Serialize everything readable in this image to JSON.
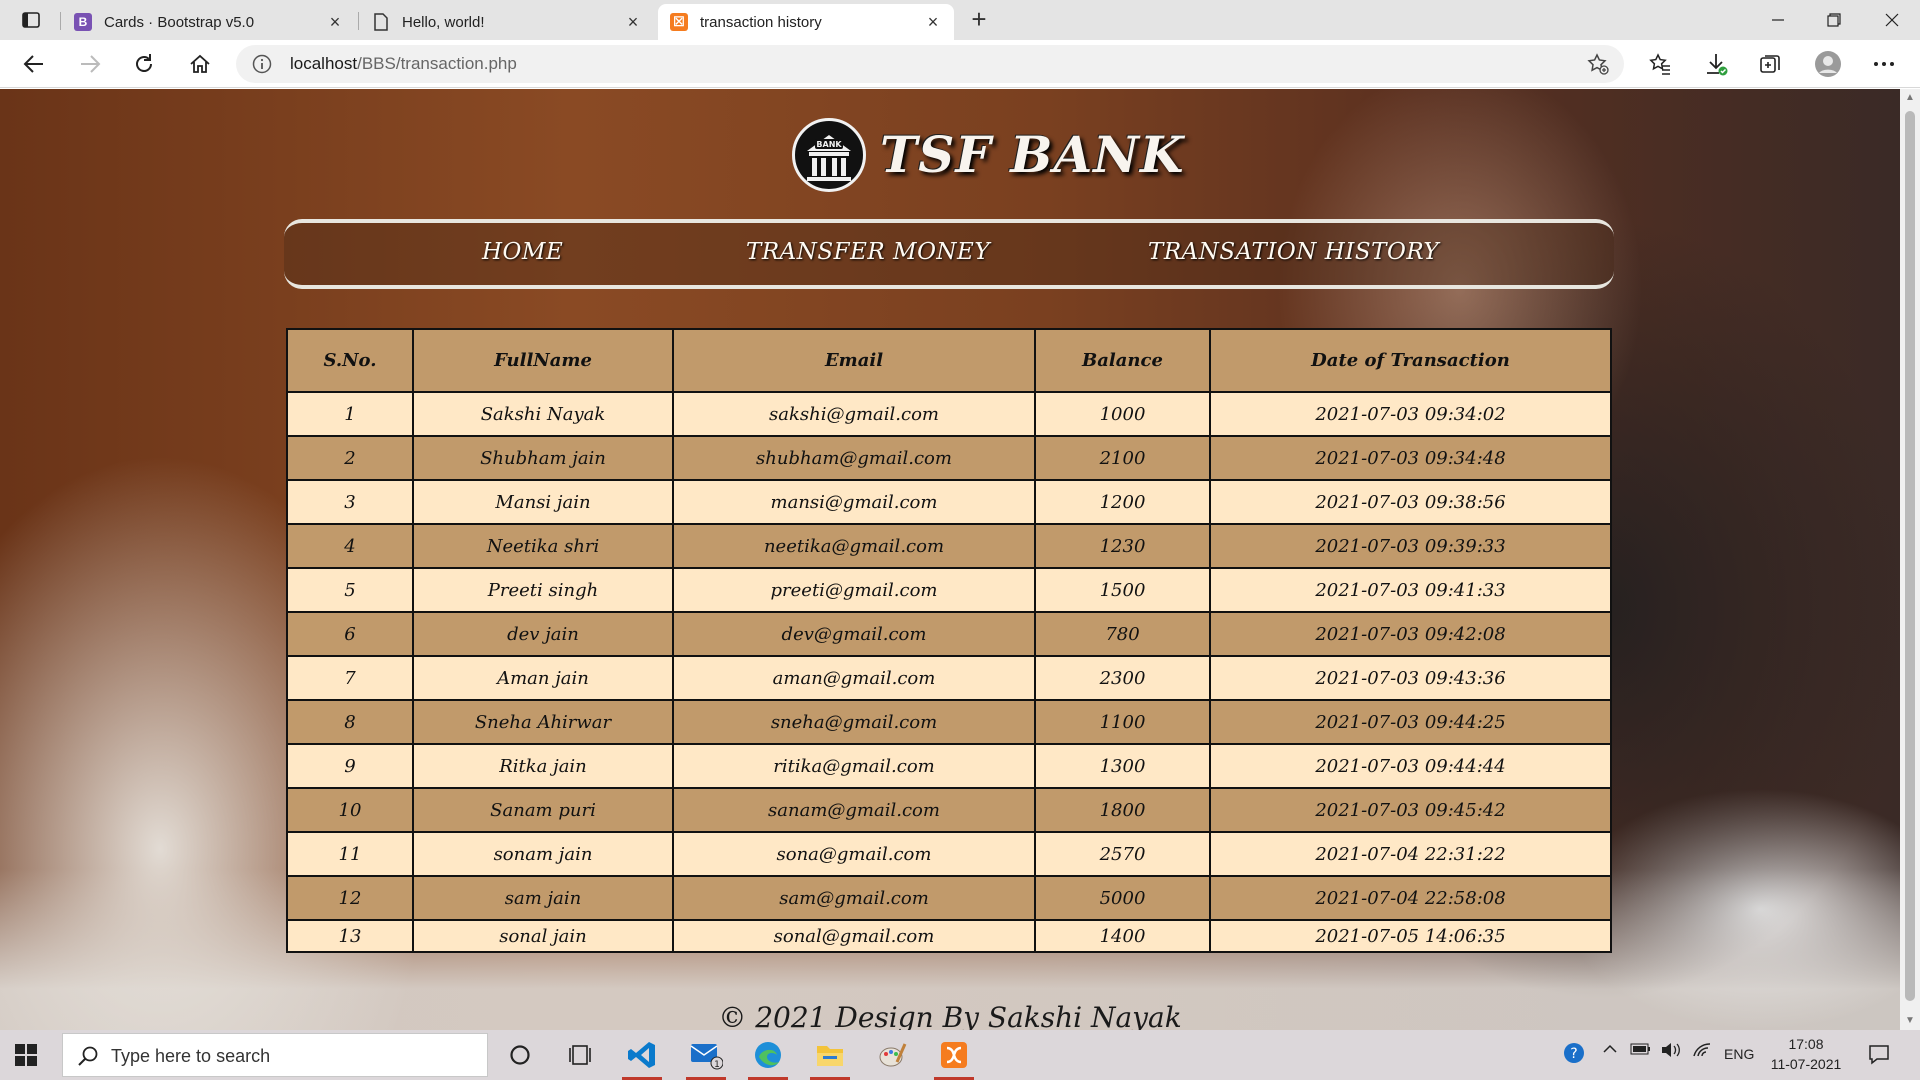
{
  "browser": {
    "tabs": [
      {
        "title": "Cards · Bootstrap v5.0",
        "favicon": "B",
        "favicon_color": "#7952b3"
      },
      {
        "title": "Hello, world!",
        "favicon": "",
        "favicon_color": "#ffffff"
      },
      {
        "title": "transaction history",
        "favicon": "☒",
        "favicon_color": "#f57c1f",
        "active": true
      }
    ],
    "url_host": "localhost",
    "url_path": "/BBS/transaction.php"
  },
  "page": {
    "brand": "TSF BANK",
    "logo_text": "BANK",
    "nav": [
      "HOME",
      "TRANSFER MONEY",
      "TRANSATION HISTORY"
    ],
    "table": {
      "headers": [
        "S.No.",
        "FullName",
        "Email",
        "Balance",
        "Date of Transaction"
      ],
      "rows": [
        [
          "1",
          "Sakshi Nayak",
          "sakshi@gmail.com",
          "1000",
          "2021-07-03 09:34:02"
        ],
        [
          "2",
          "Shubham jain",
          "shubham@gmail.com",
          "2100",
          "2021-07-03 09:34:48"
        ],
        [
          "3",
          "Mansi jain",
          "mansi@gmail.com",
          "1200",
          "2021-07-03 09:38:56"
        ],
        [
          "4",
          "Neetika shri",
          "neetika@gmail.com",
          "1230",
          "2021-07-03 09:39:33"
        ],
        [
          "5",
          "Preeti singh",
          "preeti@gmail.com",
          "1500",
          "2021-07-03 09:41:33"
        ],
        [
          "6",
          "dev jain",
          "dev@gmail.com",
          "780",
          "2021-07-03 09:42:08"
        ],
        [
          "7",
          "Aman jain",
          "aman@gmail.com",
          "2300",
          "2021-07-03 09:43:36"
        ],
        [
          "8",
          "Sneha Ahirwar",
          "sneha@gmail.com",
          "1100",
          "2021-07-03 09:44:25"
        ],
        [
          "9",
          "Ritka jain",
          "ritika@gmail.com",
          "1300",
          "2021-07-03 09:44:44"
        ],
        [
          "10",
          "Sanam puri",
          "sanam@gmail.com",
          "1800",
          "2021-07-03 09:45:42"
        ],
        [
          "11",
          "sonam jain",
          "sona@gmail.com",
          "2570",
          "2021-07-04 22:31:22"
        ],
        [
          "12",
          "sam jain",
          "sam@gmail.com",
          "5000",
          "2021-07-04 22:58:08"
        ],
        [
          "13",
          "sonal jain",
          "sonal@gmail.com",
          "1400",
          "2021-07-05 14:06:35"
        ]
      ]
    },
    "footer": "© 2021 Design By Sakshi Nayak"
  },
  "taskbar": {
    "search_placeholder": "Type here to search",
    "mail_badge": "1",
    "lang": "ENG",
    "time": "17:08",
    "date": "11-07-2021"
  }
}
